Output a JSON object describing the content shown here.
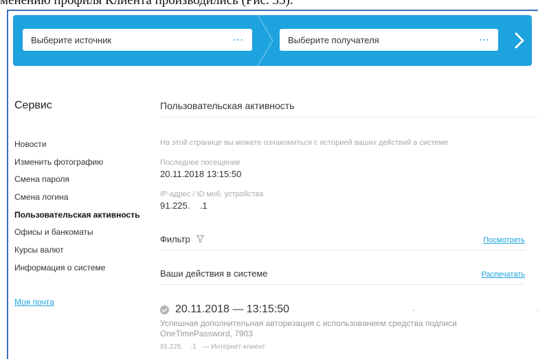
{
  "caption": "менению профиля Клиента производились (Рис. 35).",
  "transfer": {
    "source_label": "Выберите источник",
    "target_label": "Выберите получателя",
    "dots": "···",
    "accent": "#1da3de"
  },
  "sidebar": {
    "title": "Сервис",
    "items": [
      {
        "label": "Новости"
      },
      {
        "label": "Изменить фотографию"
      },
      {
        "label": "Смена пароля"
      },
      {
        "label": "Смена логина"
      },
      {
        "label": "Пользовательская активность"
      },
      {
        "label": "Офисы и банкоматы"
      },
      {
        "label": "Курсы валют"
      },
      {
        "label": "Информация о системе"
      }
    ],
    "active_index": 4,
    "mail_link": "Моя почта"
  },
  "main": {
    "title": "Пользовательская активность",
    "intro": "На этой странице вы можете ознакомиться с историей ваших действий в системе",
    "last_visit_label": "Последнее посещение",
    "last_visit_value": "20.11.2018 13:15:50",
    "ip_label": "IP-адрес / ID моб. устройства",
    "ip_value": "91.225.    .1",
    "filter_label": "Фильтр",
    "filter_link": "Посмотреть",
    "actions_title": "Ваши действия в системе",
    "print_link": "Распечатать",
    "event": {
      "datetime": "20.11.2018 — 13:15:50",
      "description": "Успешная дополнительная авторизация с использованием средства подписи OneTimePassword, 7903",
      "ip": "91.225.    .1",
      "channel": "— Интернет-клиент"
    }
  }
}
